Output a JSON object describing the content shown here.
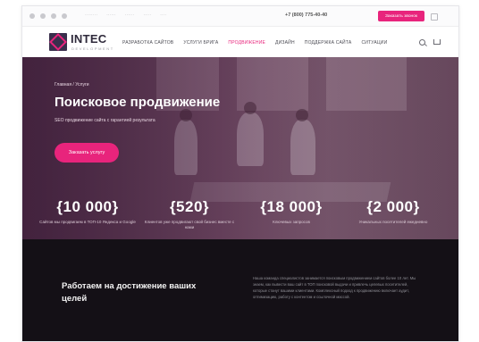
{
  "topbar": {
    "links": [
      "········",
      "······",
      "······",
      "·····",
      "····"
    ],
    "phone": "+7 (800) 775-40-40",
    "callback_label": "Заказать звонок"
  },
  "nav": {
    "logo": "INTEC",
    "logo_sub": "DEVELOPMENT",
    "items": [
      {
        "label": "Разработка сайтов",
        "active": false
      },
      {
        "label": "Услуги брига",
        "active": false
      },
      {
        "label": "Продвижение",
        "active": true
      },
      {
        "label": "Дизайн",
        "active": false
      },
      {
        "label": "Поддержка сайта",
        "active": false
      },
      {
        "label": "Ситуации",
        "active": false
      }
    ]
  },
  "hero": {
    "breadcrumb": "Главная / Услуги",
    "title": "Поисковое продвижение",
    "subtitle": "SEO продвижение сайта с гарантией результата",
    "cta_label": "Заказать услугу"
  },
  "stats": [
    {
      "value": "{10 000}",
      "caption": "Сайтов мы продвигаем в ТОП-10 Яндекса и Google"
    },
    {
      "value": "{520}",
      "caption": "Клиентов уже продвигают свой бизнес вместе с нами"
    },
    {
      "value": "{18 000}",
      "caption": "Ключевых запросов"
    },
    {
      "value": "{2 000}",
      "caption": "Уникальных посетителей ежедневно"
    }
  ],
  "section": {
    "title": "Работаем на достижение ваших целей",
    "text": "Наша команда специалистов занимается поисковым продвижением сайтов более 10 лет. Мы знаем, как вывести ваш сайт в ТОП поисковой выдачи и привлечь целевых посетителей, которые станут вашими клиентами. Комплексный подход к продвижению включает аудит, оптимизацию, работу с контентом и ссылочной массой."
  },
  "colors": {
    "accent": "#e8247c",
    "hero_overlay": "#5a3552",
    "dark_bg": "#141016"
  }
}
